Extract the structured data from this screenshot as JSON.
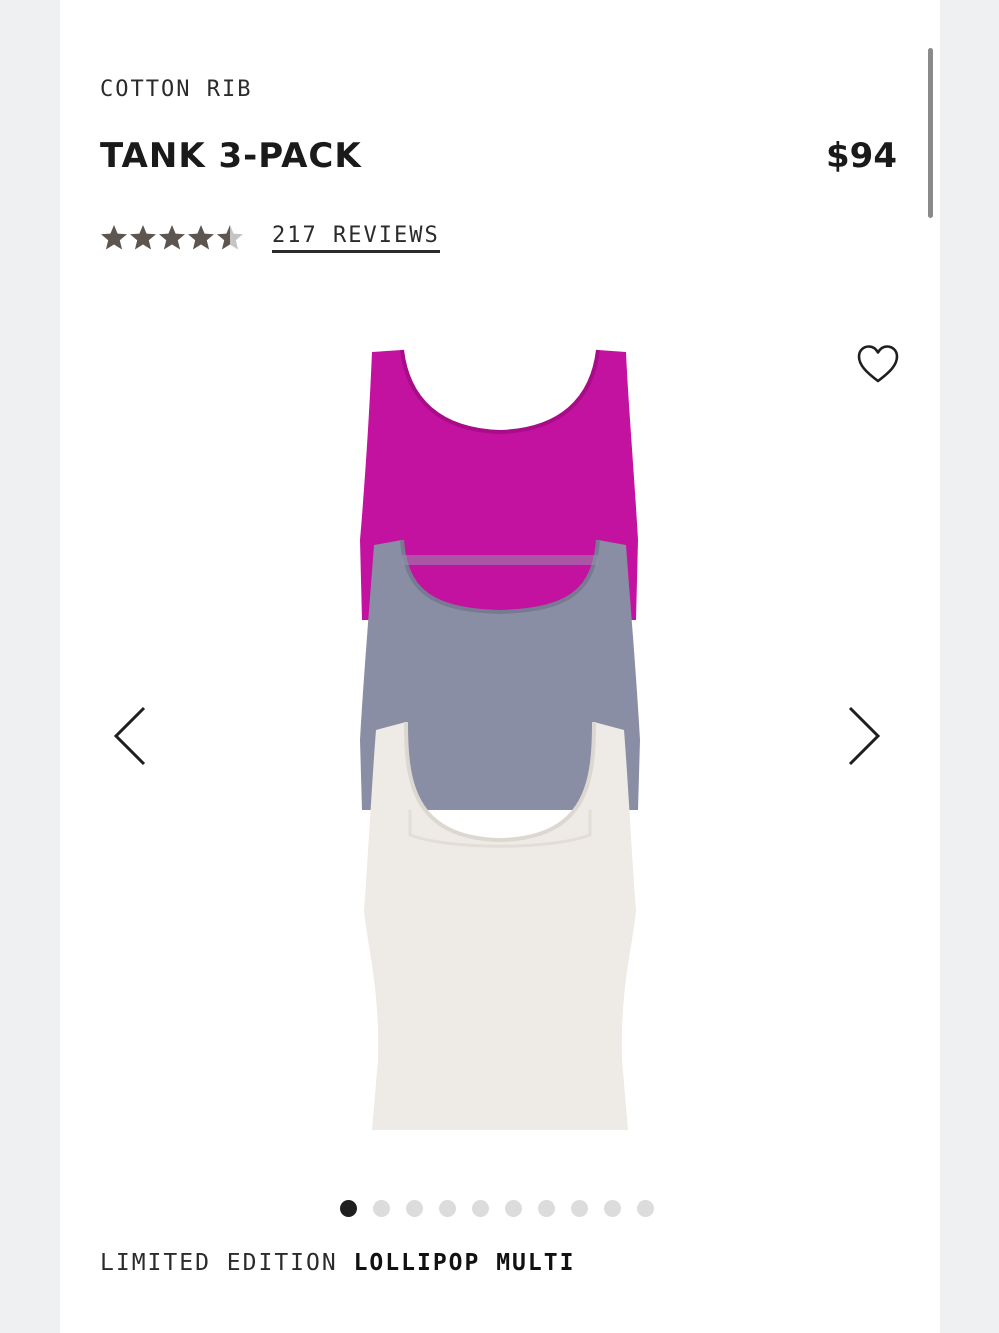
{
  "product": {
    "category": "COTTON RIB",
    "name": "TANK 3-PACK",
    "price": "$94",
    "rating": 4.5,
    "reviews_label": "217 REVIEWS",
    "edition_prefix": "LIMITED EDITION",
    "color_name": "LOLLIPOP MULTI"
  },
  "gallery": {
    "image_count": 10,
    "active_index": 0,
    "image_colors": {
      "top": "#c3129f",
      "middle": "#8a8ea4",
      "bottom": "#eeeae6"
    }
  },
  "icons": {
    "wishlist": "heart-icon",
    "prev": "chevron-left-icon",
    "next": "chevron-right-icon",
    "star": "star-icon"
  },
  "colors": {
    "star": "#5d5650",
    "text": "#1f1f1f"
  }
}
